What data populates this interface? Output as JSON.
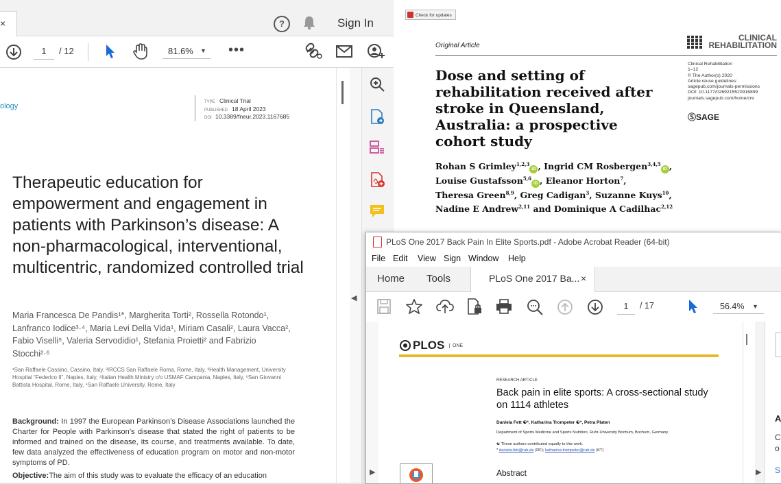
{
  "left_window": {
    "tab_close": "×",
    "signin": "Sign In",
    "toolbar": {
      "page_current": "1",
      "page_total": "/ 12",
      "zoom": "81.6%",
      "more": "•••"
    },
    "document": {
      "journal_fragment": "ology",
      "meta": {
        "type_label": "TYPE",
        "type_value": "Clinical Trial",
        "published_label": "PUBLISHED",
        "published_value": "18 April 2023",
        "doi_label": "DOI",
        "doi_value": "10.3389/fneur.2023.1167685"
      },
      "title": "Therapeutic education for empowerment and engagement in patients with Parkinson’s disease: A non-pharmacological, interventional, multicentric, randomized controlled trial",
      "authors": "Maria Francesca De Pandis¹*, Margherita Torti², Rossella Rotondo¹, Lanfranco Iodice³·⁴, Maria Levi Della Vida¹, Miriam Casali², Laura Vacca², Fabio Viselli⁵, Valeria Servodidio¹, Stefania Proietti² and Fabrizio Stocchi²·⁶",
      "affiliations": "¹San Raffaele Cassino, Cassino, Italy, ²IRCCS San Raffaele Roma, Rome, Italy, ³Health Management, University Hospital “Federico II”, Naples, Italy, ⁴Italian Health Ministry c/o USMAF Campania, Naples, Italy, ⁵San Giovanni Battista Hospital, Rome, Italy, ⁶San Raffaele University, Rome, Italy",
      "background_label": "Background:",
      "background_text": "In 1997 the European Parkinson’s Disease Associations launched the Charter for People with Parkinson’s disease that stated the right of patients to be informed and trained on the disease, its course, and treatments available. To date, few data analyzed the effectiveness of education program on motor and non-motor symptoms of PD.",
      "objective_label": "Objective:",
      "objective_text": "The aim of this study was to evaluate the efficacy of an education program"
    }
  },
  "right_window": {
    "update_button": "Check for updates",
    "article_type": "Original Article",
    "journal_line1": "CLINICAL",
    "journal_line2": "REHABILITATION",
    "title": "Dose and setting of rehabilitation received after stroke in Queensland, Australia: a prospective cohort study",
    "meta_lines": [
      "Clinical Rehabilitation",
      "1–12",
      "© The Author(s) 2020",
      "Article reuse guidelines:",
      "sagepub.com/journals-permissions",
      "DOI: 10.1177/0269215520916899",
      "journals.sagepub.com/home/cre"
    ],
    "publisher": "SAGE",
    "authors": {
      "a1": "Rohan S Grimley",
      "a1s": "1,2,3",
      "a2": "Ingrid CM Rosbergen",
      "a2s": "3,4,5",
      "a3": "Louise Gustafsson",
      "a3s": "5,6",
      "a4": "Eleanor Horton",
      "a4s": "7",
      "a5": "Theresa Green",
      "a5s": "8,9",
      "a6": "Greg Cadigan",
      "a6s": "3",
      "a7": "Suzanne Kuys",
      "a7s": "10",
      "a8": "Nadine E Andrew",
      "a8s": "2,11",
      "a9": "Dominique A Cadilhac",
      "a9s": "2,12",
      "orcid": "iD"
    }
  },
  "front_window": {
    "title": "PLoS One 2017 Back Pain In Elite Sports.pdf - Adobe Acrobat Reader (64-bit)",
    "menu": [
      "File",
      "Edit",
      "View",
      "Sign",
      "Window",
      "Help"
    ],
    "tabs": {
      "home": "Home",
      "tools": "Tools",
      "doc": "PLoS One 2017 Ba...",
      "close": "×"
    },
    "toolbar": {
      "page_current": "1",
      "page_total": "/ 17",
      "zoom": "56.4%"
    },
    "document": {
      "brand": "PLOS",
      "brand_sub": "ONE",
      "article_type": "RESEARCH ARTICLE",
      "title": "Back pain in elite sports: A cross-sectional study on 1114 athletes",
      "authors": "Daniela Fett ☯*, Katharina Trompeter ☯*, Petra Platen",
      "department": "Department of Sports Medicine and Sports Nutrition, Ruhr-University Bochum, Bochum, Germany",
      "note1": "☯ These authors contributed equally to this work.",
      "note2_prefix": "* ",
      "email1": "daniela.fett@rub.de",
      "email1_suffix": " (DF); ",
      "email2": "katharina.trompeter@rub.de",
      "email2_suffix": " (KT)",
      "abstract_heading": "Abstract"
    },
    "right_pane_fragments": [
      "A",
      "C",
      "o",
      "S"
    ]
  }
}
